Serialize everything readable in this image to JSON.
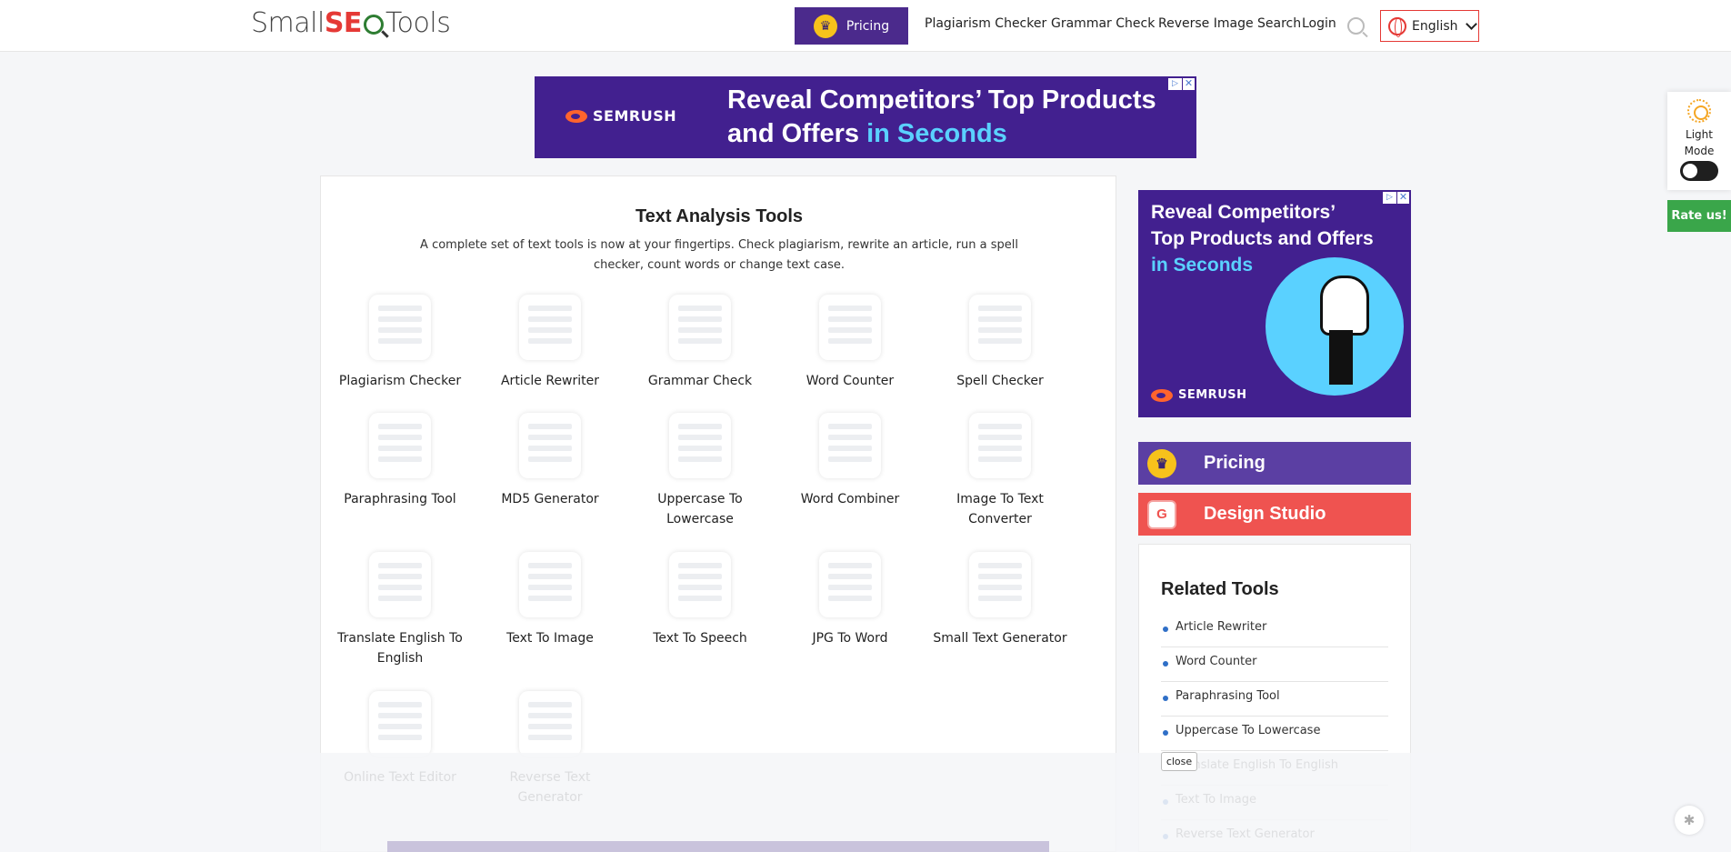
{
  "header": {
    "logo": {
      "part1": "Small",
      "part2": "SE",
      "part3": "Tools"
    },
    "pricing_label": "Pricing",
    "nav": [
      "Plagiarism Checker",
      "Grammar Check",
      "Reverse Image Search",
      "Login"
    ],
    "language": "English"
  },
  "ad_top": {
    "brand": "SEMRUSH",
    "headline_line1": "Reveal Competitors’ Top Products",
    "headline_line2": "and Offers",
    "headline_highlight": "in Seconds"
  },
  "main": {
    "title": "Text Analysis Tools",
    "description": "A complete set of text tools is now at your fingertips. Check plagiarism, rewrite an article, run a spell checker, count words or change text case.",
    "tools": [
      "Plagiarism Checker",
      "Article Rewriter",
      "Grammar Check",
      "Word Counter",
      "Spell Checker",
      "Paraphrasing Tool",
      "MD5 Generator",
      "Uppercase To Lowercase",
      "Word Combiner",
      "Image To Text Converter",
      "Translate English To English",
      "Text To Image",
      "Text To Speech",
      "JPG To Word",
      "Small Text Generator",
      "Online Text Editor",
      "Reverse Text Generator"
    ]
  },
  "ad_side": {
    "headline_line1": "Reveal Competitors’",
    "headline_line2": "Top Products and Offers",
    "headline_highlight": "in Seconds",
    "brand": "SEMRUSH"
  },
  "sidebar": {
    "pricing_label": "Pricing",
    "design_label": "Design Studio",
    "related_title": "Related Tools",
    "related_items": [
      "Article Rewriter",
      "Word Counter",
      "Paraphrasing Tool",
      "Uppercase To Lowercase",
      "Translate English To English",
      "Text To Image",
      "Reverse Text Generator"
    ]
  },
  "widgets": {
    "light_mode_label_1": "Light",
    "light_mode_label_2": "Mode",
    "rate_label": "Rate us!",
    "close_label": "close"
  },
  "colors": {
    "brand_purple": "#4b2a8c",
    "ad_purple": "#42208f",
    "accent_red": "#e53935",
    "design_red": "#ef5350",
    "rate_green": "#3aa64a"
  }
}
